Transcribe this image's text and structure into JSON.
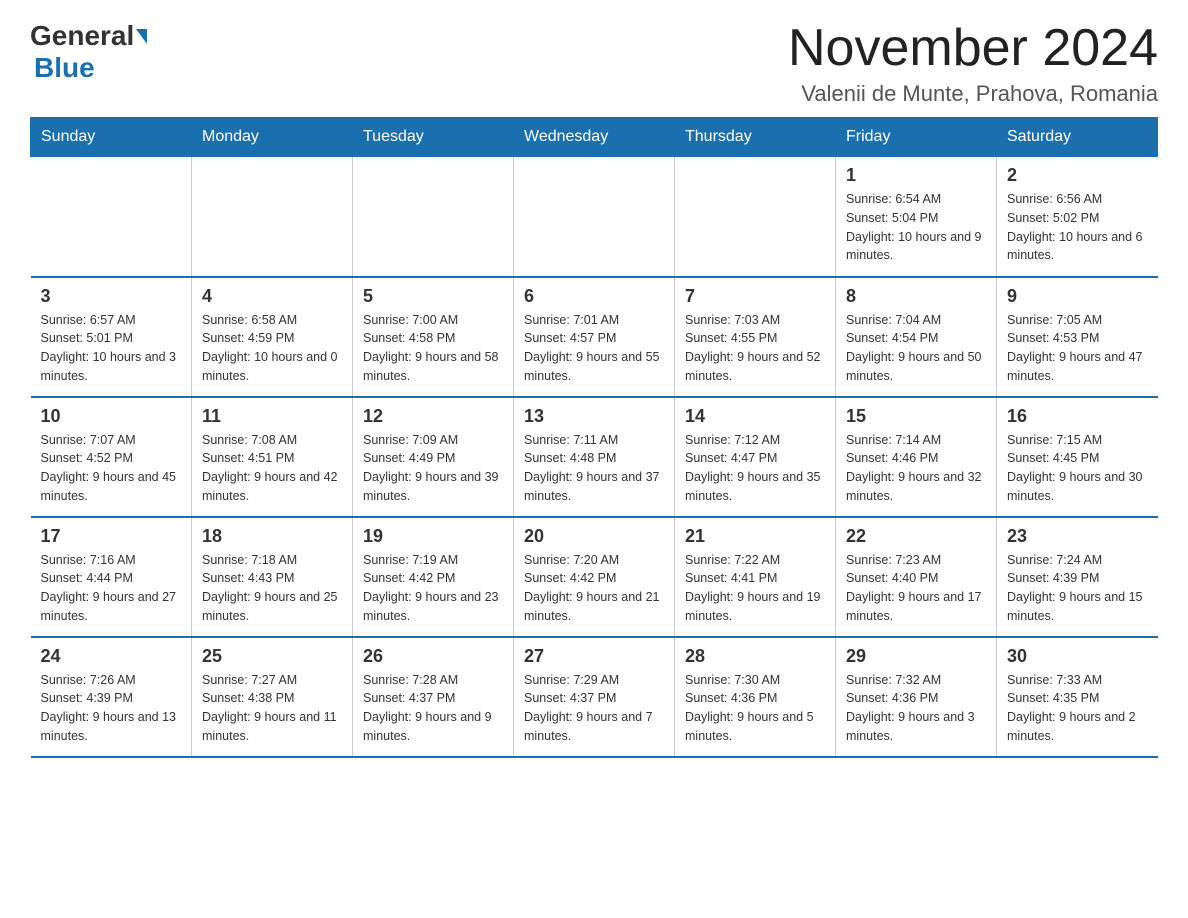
{
  "header": {
    "logo_general": "General",
    "logo_blue": "Blue",
    "month_title": "November 2024",
    "location": "Valenii de Munte, Prahova, Romania"
  },
  "days_of_week": [
    "Sunday",
    "Monday",
    "Tuesday",
    "Wednesday",
    "Thursday",
    "Friday",
    "Saturday"
  ],
  "weeks": [
    {
      "days": [
        {
          "num": "",
          "info": ""
        },
        {
          "num": "",
          "info": ""
        },
        {
          "num": "",
          "info": ""
        },
        {
          "num": "",
          "info": ""
        },
        {
          "num": "",
          "info": ""
        },
        {
          "num": "1",
          "info": "Sunrise: 6:54 AM\nSunset: 5:04 PM\nDaylight: 10 hours and 9 minutes."
        },
        {
          "num": "2",
          "info": "Sunrise: 6:56 AM\nSunset: 5:02 PM\nDaylight: 10 hours and 6 minutes."
        }
      ]
    },
    {
      "days": [
        {
          "num": "3",
          "info": "Sunrise: 6:57 AM\nSunset: 5:01 PM\nDaylight: 10 hours and 3 minutes."
        },
        {
          "num": "4",
          "info": "Sunrise: 6:58 AM\nSunset: 4:59 PM\nDaylight: 10 hours and 0 minutes."
        },
        {
          "num": "5",
          "info": "Sunrise: 7:00 AM\nSunset: 4:58 PM\nDaylight: 9 hours and 58 minutes."
        },
        {
          "num": "6",
          "info": "Sunrise: 7:01 AM\nSunset: 4:57 PM\nDaylight: 9 hours and 55 minutes."
        },
        {
          "num": "7",
          "info": "Sunrise: 7:03 AM\nSunset: 4:55 PM\nDaylight: 9 hours and 52 minutes."
        },
        {
          "num": "8",
          "info": "Sunrise: 7:04 AM\nSunset: 4:54 PM\nDaylight: 9 hours and 50 minutes."
        },
        {
          "num": "9",
          "info": "Sunrise: 7:05 AM\nSunset: 4:53 PM\nDaylight: 9 hours and 47 minutes."
        }
      ]
    },
    {
      "days": [
        {
          "num": "10",
          "info": "Sunrise: 7:07 AM\nSunset: 4:52 PM\nDaylight: 9 hours and 45 minutes."
        },
        {
          "num": "11",
          "info": "Sunrise: 7:08 AM\nSunset: 4:51 PM\nDaylight: 9 hours and 42 minutes."
        },
        {
          "num": "12",
          "info": "Sunrise: 7:09 AM\nSunset: 4:49 PM\nDaylight: 9 hours and 39 minutes."
        },
        {
          "num": "13",
          "info": "Sunrise: 7:11 AM\nSunset: 4:48 PM\nDaylight: 9 hours and 37 minutes."
        },
        {
          "num": "14",
          "info": "Sunrise: 7:12 AM\nSunset: 4:47 PM\nDaylight: 9 hours and 35 minutes."
        },
        {
          "num": "15",
          "info": "Sunrise: 7:14 AM\nSunset: 4:46 PM\nDaylight: 9 hours and 32 minutes."
        },
        {
          "num": "16",
          "info": "Sunrise: 7:15 AM\nSunset: 4:45 PM\nDaylight: 9 hours and 30 minutes."
        }
      ]
    },
    {
      "days": [
        {
          "num": "17",
          "info": "Sunrise: 7:16 AM\nSunset: 4:44 PM\nDaylight: 9 hours and 27 minutes."
        },
        {
          "num": "18",
          "info": "Sunrise: 7:18 AM\nSunset: 4:43 PM\nDaylight: 9 hours and 25 minutes."
        },
        {
          "num": "19",
          "info": "Sunrise: 7:19 AM\nSunset: 4:42 PM\nDaylight: 9 hours and 23 minutes."
        },
        {
          "num": "20",
          "info": "Sunrise: 7:20 AM\nSunset: 4:42 PM\nDaylight: 9 hours and 21 minutes."
        },
        {
          "num": "21",
          "info": "Sunrise: 7:22 AM\nSunset: 4:41 PM\nDaylight: 9 hours and 19 minutes."
        },
        {
          "num": "22",
          "info": "Sunrise: 7:23 AM\nSunset: 4:40 PM\nDaylight: 9 hours and 17 minutes."
        },
        {
          "num": "23",
          "info": "Sunrise: 7:24 AM\nSunset: 4:39 PM\nDaylight: 9 hours and 15 minutes."
        }
      ]
    },
    {
      "days": [
        {
          "num": "24",
          "info": "Sunrise: 7:26 AM\nSunset: 4:39 PM\nDaylight: 9 hours and 13 minutes."
        },
        {
          "num": "25",
          "info": "Sunrise: 7:27 AM\nSunset: 4:38 PM\nDaylight: 9 hours and 11 minutes."
        },
        {
          "num": "26",
          "info": "Sunrise: 7:28 AM\nSunset: 4:37 PM\nDaylight: 9 hours and 9 minutes."
        },
        {
          "num": "27",
          "info": "Sunrise: 7:29 AM\nSunset: 4:37 PM\nDaylight: 9 hours and 7 minutes."
        },
        {
          "num": "28",
          "info": "Sunrise: 7:30 AM\nSunset: 4:36 PM\nDaylight: 9 hours and 5 minutes."
        },
        {
          "num": "29",
          "info": "Sunrise: 7:32 AM\nSunset: 4:36 PM\nDaylight: 9 hours and 3 minutes."
        },
        {
          "num": "30",
          "info": "Sunrise: 7:33 AM\nSunset: 4:35 PM\nDaylight: 9 hours and 2 minutes."
        }
      ]
    }
  ]
}
